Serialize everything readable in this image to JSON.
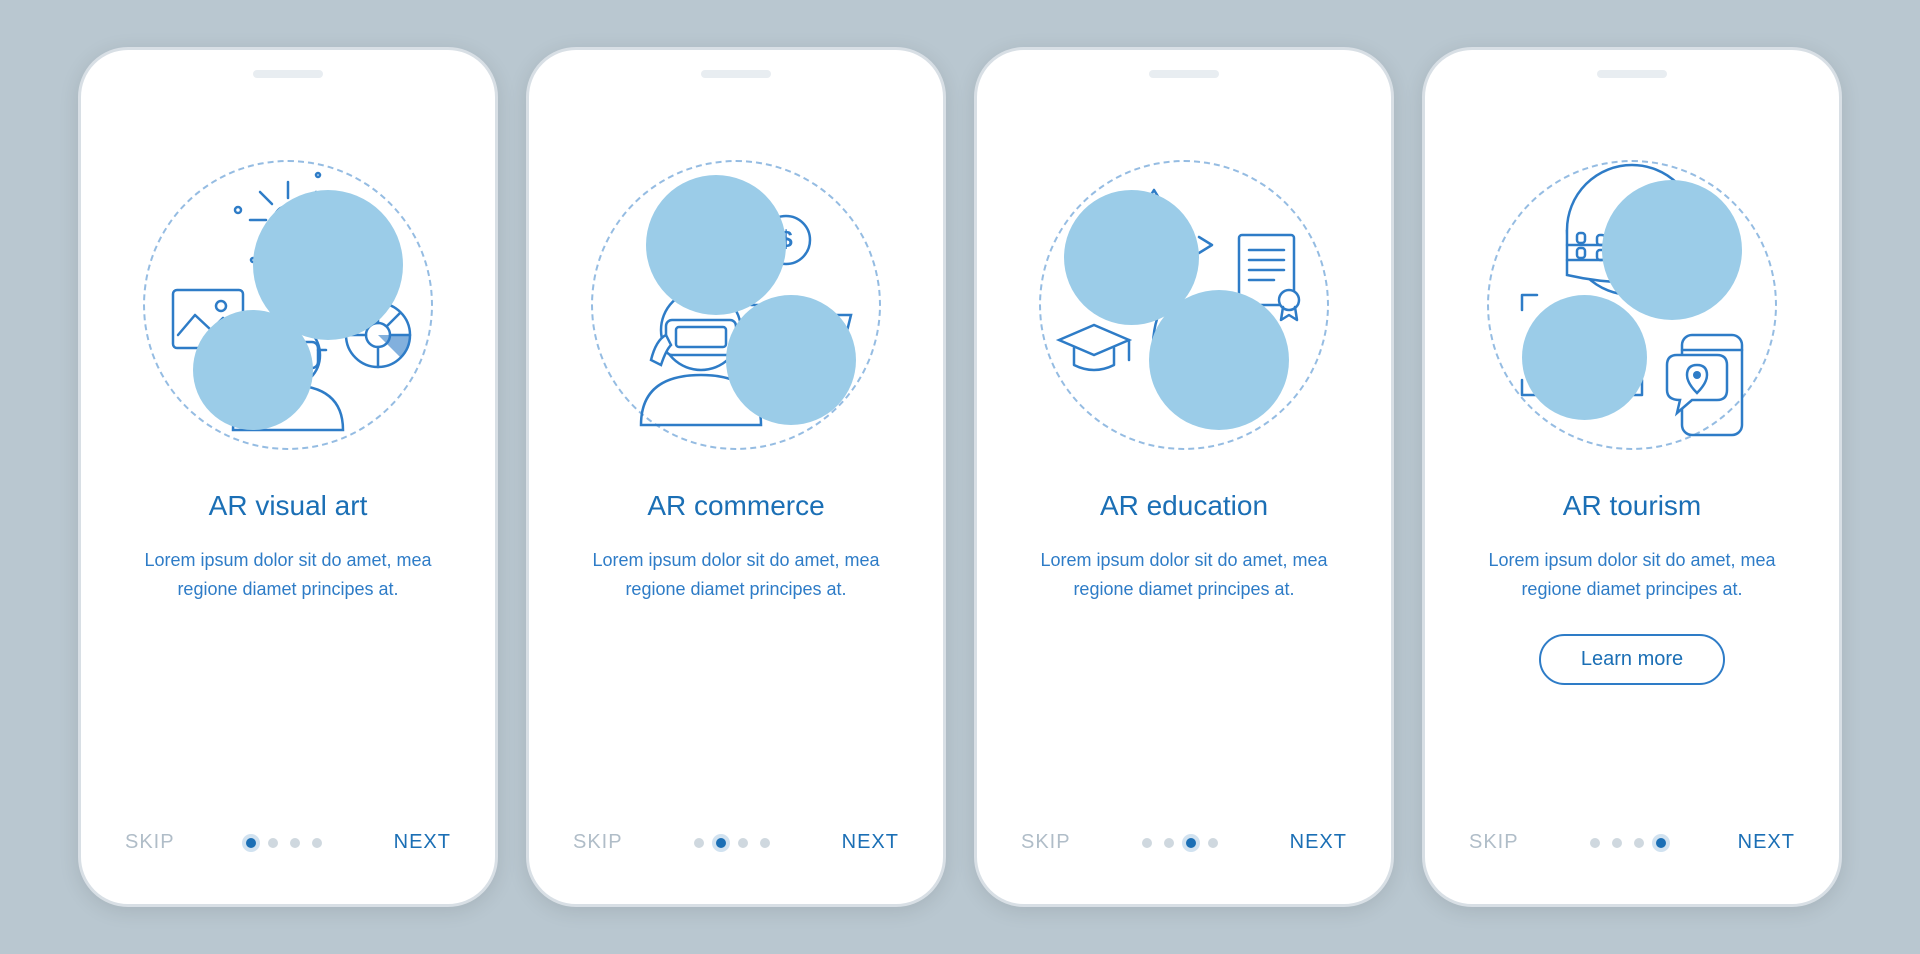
{
  "common": {
    "skip_label": "SKIP",
    "next_label": "NEXT",
    "description": "Lorem ipsum dolor sit do amet, mea regione diamet principes at."
  },
  "screens": [
    {
      "title": "AR visual art",
      "icon": "visual-art",
      "active_dot": 0,
      "has_cta": false
    },
    {
      "title": "AR commerce",
      "icon": "commerce",
      "active_dot": 1,
      "has_cta": false
    },
    {
      "title": "AR education",
      "icon": "education",
      "active_dot": 2,
      "has_cta": false
    },
    {
      "title": "AR tourism",
      "icon": "tourism",
      "active_dot": 3,
      "has_cta": true,
      "cta_label": "Learn more"
    }
  ],
  "colors": {
    "background": "#b9c7d0",
    "primary": "#1b6fb5",
    "accent": "#2e7cc7",
    "light_blue": "#9bcce8",
    "muted": "#b0bdc8"
  }
}
